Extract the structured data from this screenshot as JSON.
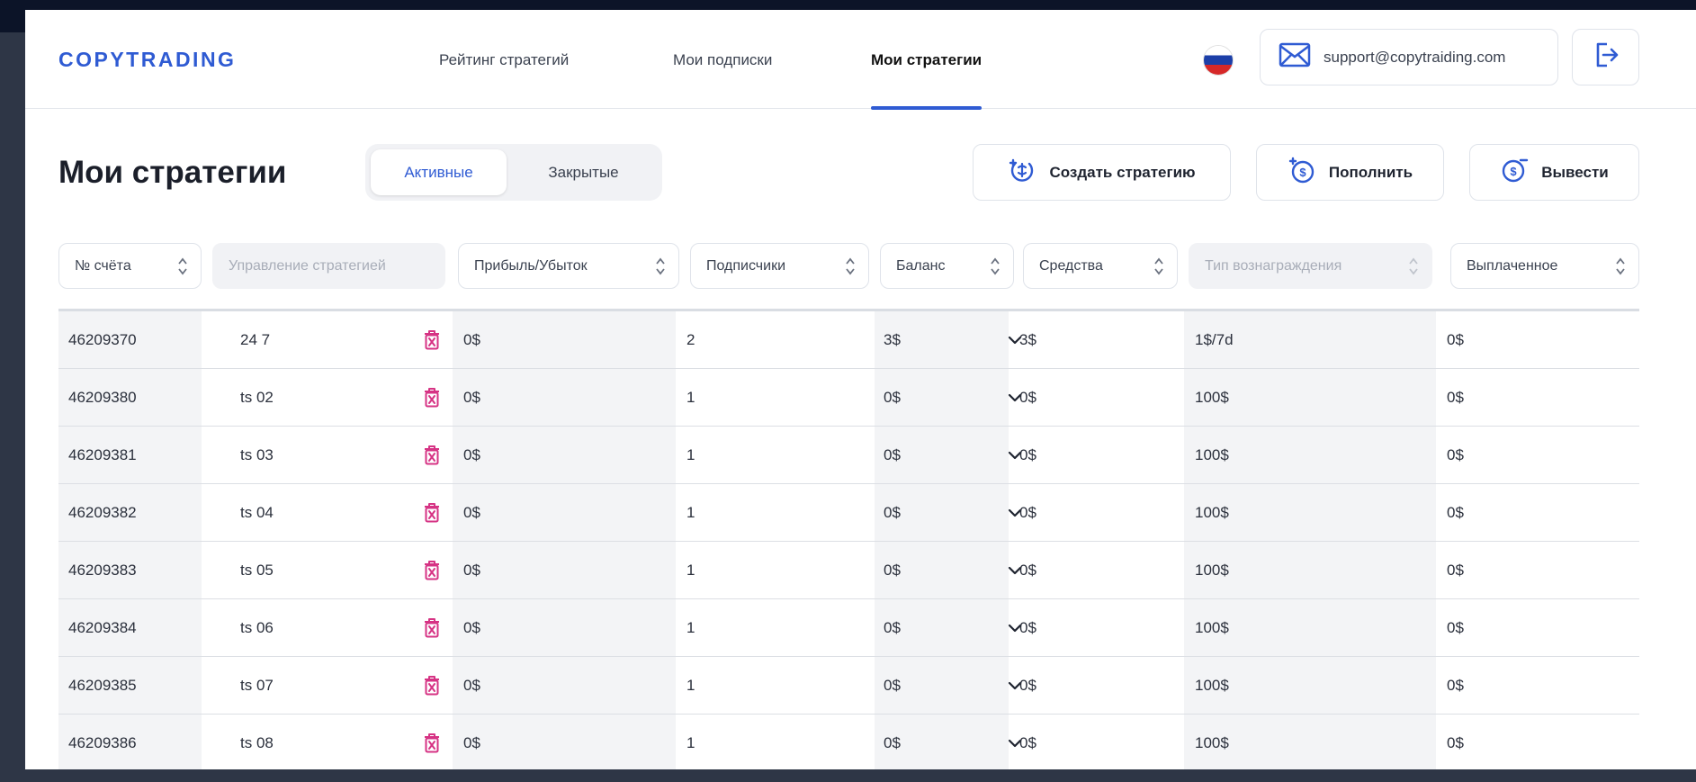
{
  "header": {
    "logo": "COPYTRADING",
    "nav": [
      {
        "label": "Рейтинг стратегий",
        "active": false
      },
      {
        "label": "Мои подписки",
        "active": false
      },
      {
        "label": "Мои стратегии",
        "active": true
      }
    ],
    "language_flag": "ru-flag-icon",
    "support_email": "support@copytraiding.com",
    "logout_icon": "logout-icon"
  },
  "page": {
    "title": "Мои стратегии",
    "tabs": [
      {
        "label": "Активные",
        "active": true
      },
      {
        "label": "Закрытые",
        "active": false
      }
    ],
    "actions": {
      "create": "Создать стратегию",
      "deposit": "Пополнить",
      "withdraw": "Вывести"
    }
  },
  "filters": [
    {
      "label": "№ счёта",
      "disabled": false
    },
    {
      "label": "Управление стратегией",
      "disabled": true
    },
    {
      "label": "Прибыль/Убыток",
      "disabled": false
    },
    {
      "label": "Подписчики",
      "disabled": false
    },
    {
      "label": "Баланс",
      "disabled": false
    },
    {
      "label": "Средства",
      "disabled": false
    },
    {
      "label": "Тип вознаграждения",
      "disabled": true
    },
    {
      "label": "Выплаченное",
      "disabled": false
    }
  ],
  "rows": [
    {
      "account": "46209370",
      "name": "24 7",
      "pnl": "0$",
      "subscribers": "2",
      "balance": "3$",
      "funds": "3$",
      "reward": "1$/7d",
      "paid": "0$"
    },
    {
      "account": "46209380",
      "name": "ts 02",
      "pnl": "0$",
      "subscribers": "1",
      "balance": "0$",
      "funds": "0$",
      "reward": "100$",
      "paid": "0$"
    },
    {
      "account": "46209381",
      "name": "ts 03",
      "pnl": "0$",
      "subscribers": "1",
      "balance": "0$",
      "funds": "0$",
      "reward": "100$",
      "paid": "0$"
    },
    {
      "account": "46209382",
      "name": "ts 04",
      "pnl": "0$",
      "subscribers": "1",
      "balance": "0$",
      "funds": "0$",
      "reward": "100$",
      "paid": "0$"
    },
    {
      "account": "46209383",
      "name": "ts 05",
      "pnl": "0$",
      "subscribers": "1",
      "balance": "0$",
      "funds": "0$",
      "reward": "100$",
      "paid": "0$"
    },
    {
      "account": "46209384",
      "name": "ts 06",
      "pnl": "0$",
      "subscribers": "1",
      "balance": "0$",
      "funds": "0$",
      "reward": "100$",
      "paid": "0$"
    },
    {
      "account": "46209385",
      "name": "ts 07",
      "pnl": "0$",
      "subscribers": "1",
      "balance": "0$",
      "funds": "0$",
      "reward": "100$",
      "paid": "0$"
    },
    {
      "account": "46209386",
      "name": "ts 08",
      "pnl": "0$",
      "subscribers": "1",
      "balance": "0$",
      "funds": "0$",
      "reward": "100$",
      "paid": "0$"
    }
  ],
  "colors": {
    "accent": "#2f5bd3",
    "delete_icon": "#d63384",
    "background": "#0c1428"
  }
}
